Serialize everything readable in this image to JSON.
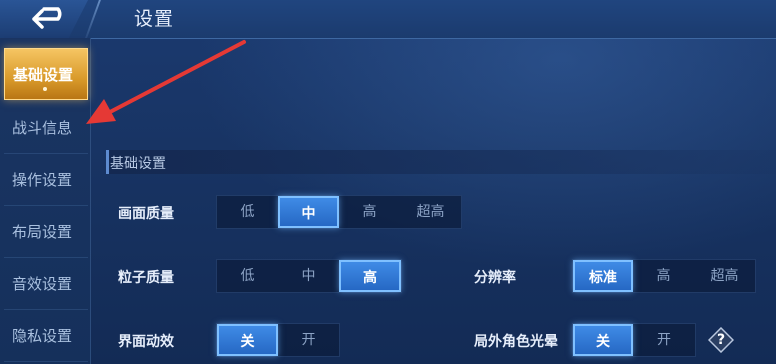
{
  "header": {
    "title": "设置"
  },
  "sidebar": {
    "items": [
      {
        "label": "基础设置",
        "active": true
      },
      {
        "label": "战斗信息",
        "active": false
      },
      {
        "label": "操作设置",
        "active": false
      },
      {
        "label": "布局设置",
        "active": false
      },
      {
        "label": "音效设置",
        "active": false
      },
      {
        "label": "隐私设置",
        "active": false
      }
    ]
  },
  "section": {
    "title": "基础设置"
  },
  "settings": {
    "graphics_quality": {
      "label": "画面质量",
      "options": [
        "低",
        "中",
        "高",
        "超高"
      ],
      "selected": "中"
    },
    "particle_quality": {
      "label": "粒子质量",
      "options": [
        "低",
        "中",
        "高"
      ],
      "selected": "高"
    },
    "resolution": {
      "label": "分辨率",
      "options": [
        "标准",
        "高",
        "超高"
      ],
      "selected": "标准"
    },
    "ui_animation": {
      "label": "界面动效",
      "options": [
        "关",
        "开"
      ],
      "selected": "关"
    },
    "outside_character_halo": {
      "label": "局外角色光晕",
      "options": [
        "关",
        "开"
      ],
      "selected": "关"
    },
    "help": {
      "icon": "question-icon",
      "glyph": "?"
    }
  },
  "colors": {
    "accent_selected": "#2f78d6",
    "active_tab": "#e0a53a",
    "annotation_arrow": "#e53935"
  }
}
